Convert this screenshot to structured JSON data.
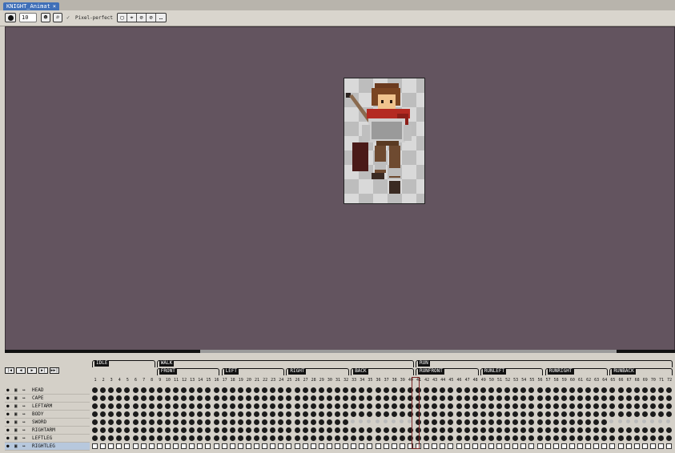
{
  "tab": {
    "title": "KNIGHT_Animat",
    "close": "×"
  },
  "toolbar": {
    "zoom_value": "10",
    "pixel_perfect_label": "Pixel-perfect",
    "check": "✓",
    "user_icon": "☻",
    "lens_icon": "⌕",
    "group_icons": [
      "▢",
      "⌖",
      "⊘",
      "⊘",
      "…"
    ]
  },
  "playback": {
    "first": "|◀",
    "prev": "◀",
    "play": "▶",
    "next": "▶|",
    "last": "▶▶|"
  },
  "tags": [
    {
      "label": "IDLE"
    },
    {
      "label": "WALK"
    },
    {
      "label": "FRONT"
    },
    {
      "label": "LEFT"
    },
    {
      "label": "RIGHT"
    },
    {
      "label": "BACK"
    },
    {
      "label": "RUN"
    },
    {
      "label": "RUNFRONT"
    },
    {
      "label": "RUNLEFT"
    },
    {
      "label": "RUNRIGHT"
    },
    {
      "label": "RUNBACK"
    }
  ],
  "frames": {
    "count": 72,
    "current": 41
  },
  "layers": [
    {
      "name": "HEAD",
      "selected": false
    },
    {
      "name": "CAPE",
      "selected": false
    },
    {
      "name": "LEFTARM",
      "selected": false
    },
    {
      "name": "BODY",
      "selected": false
    },
    {
      "name": "SWORD",
      "selected": false
    },
    {
      "name": "RIGHTARM",
      "selected": false
    },
    {
      "name": "LEFTLEG",
      "selected": false
    },
    {
      "name": "RIGHTLEG",
      "selected": true
    }
  ],
  "colors": {
    "canvas": "#63545f",
    "tab": "#3f6fb8",
    "cape": "#b42a22"
  }
}
